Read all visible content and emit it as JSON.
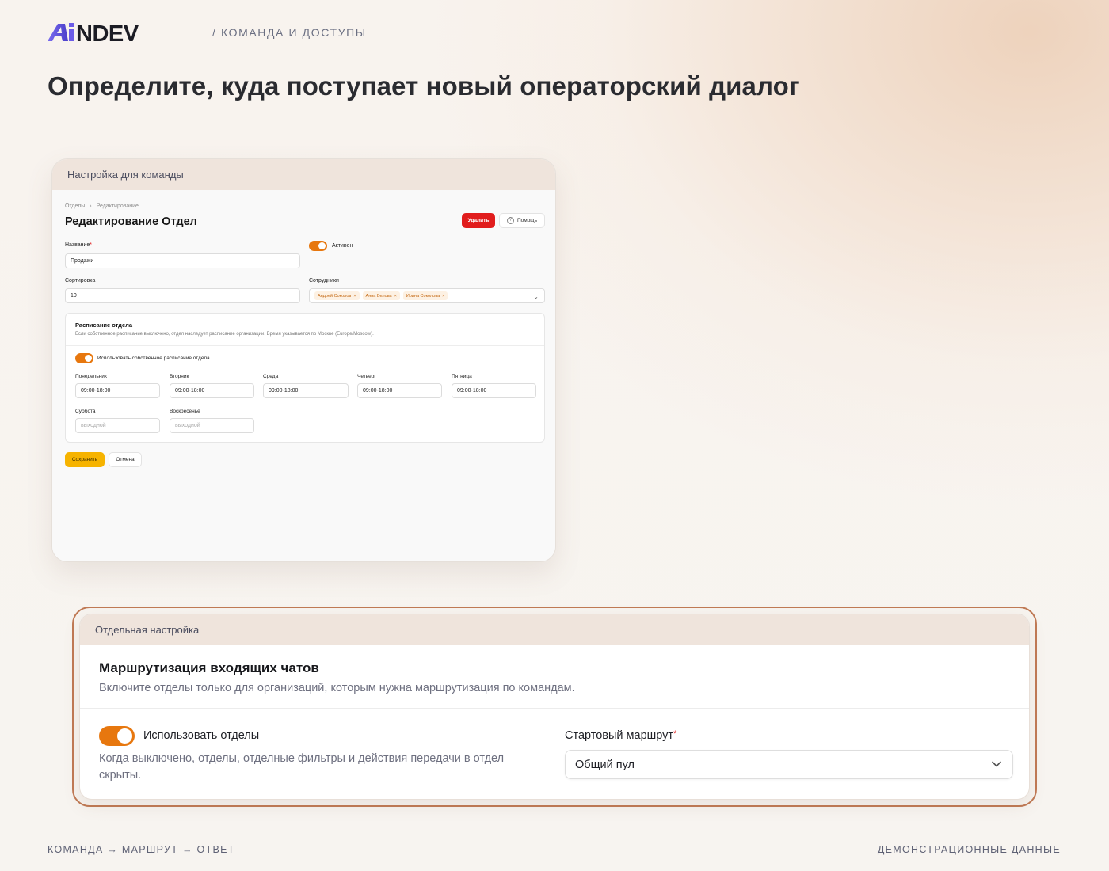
{
  "brand": {
    "logo_text": "AiNDEV"
  },
  "header": {
    "section": "/ КОМАНДА И ДОСТУПЫ",
    "title": "Определите, куда поступает новый операторский диалог"
  },
  "team_card": {
    "label": "Настройка для команды",
    "screenshot": {
      "breadcrumb": [
        "Отделы",
        "›",
        "Редактирование"
      ],
      "title": "Редактирование Отдел",
      "delete_label": "Удалить",
      "help_label": "Помощь",
      "name_label": "Название",
      "name_value": "Продажи",
      "active_label": "Активен",
      "sort_label": "Сортировка",
      "sort_value": "10",
      "employees_label": "Сотрудники",
      "employees": [
        "Андрей Соколов",
        "Анна Белова",
        "Ирина Соколова"
      ],
      "chip_remove": "×",
      "schedule": {
        "title": "Расписание отдела",
        "description": "Если собственное расписание выключено, отдел наследует расписание организации. Время указывается по Москве (Europe/Moscow).",
        "toggle_label": "Использовать собственное расписание отдела",
        "days": [
          {
            "label": "Понедельник",
            "value": "09:00-18:00",
            "placeholder": ""
          },
          {
            "label": "Вторник",
            "value": "09:00-18:00",
            "placeholder": ""
          },
          {
            "label": "Среда",
            "value": "09:00-18:00",
            "placeholder": ""
          },
          {
            "label": "Четверг",
            "value": "09:00-18:00",
            "placeholder": ""
          },
          {
            "label": "Пятница",
            "value": "09:00-18:00",
            "placeholder": ""
          },
          {
            "label": "Суббота",
            "value": "",
            "placeholder": "выходной"
          },
          {
            "label": "Воскресенье",
            "value": "",
            "placeholder": "выходной"
          }
        ]
      },
      "save_label": "Сохранить",
      "cancel_label": "Отмена"
    }
  },
  "setting_card": {
    "label": "Отдельная настройка",
    "title": "Маршрутизация входящих чатов",
    "description": "Включите отделы только для организаций, которым нужна маршрутизация по командам.",
    "toggle_label": "Использовать отделы",
    "toggle_on": true,
    "toggle_description": "Когда выключено, отделы, отделные фильтры и действия передачи в отдел скрыты.",
    "route_label": "Стартовый маршрут",
    "route_required": "*",
    "route_value": "Общий пул"
  },
  "footer": {
    "left": "КОМАНДА → МАРШРУТ → ОТВЕТ",
    "right": "ДЕМОНСТРАЦИОННЫЕ ДАННЫЕ"
  },
  "colors": {
    "accent_orange": "#e7770e",
    "danger_red": "#e11d1d",
    "save_yellow": "#f6b300",
    "frame_border": "#c07a55",
    "logo_purple": "#6c5ce7",
    "logo_dark": "#1c1c24"
  }
}
